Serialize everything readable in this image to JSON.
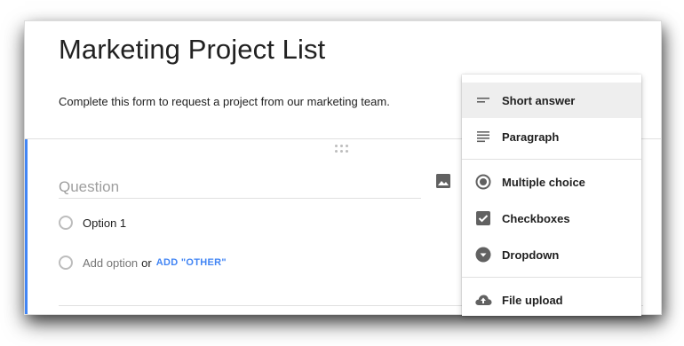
{
  "form": {
    "title": "Marketing Project List",
    "description": "Complete this form to request a project from our marketing team."
  },
  "question": {
    "placeholder": "Question",
    "options": [
      {
        "label": "Option 1"
      }
    ],
    "add_option_label": "Add option",
    "or_label": "or",
    "add_other_label": "ADD \"OTHER\""
  },
  "type_menu": {
    "items": [
      {
        "label": "Short answer",
        "icon": "short-answer-icon",
        "selected": true
      },
      {
        "label": "Paragraph",
        "icon": "paragraph-icon",
        "selected": false
      },
      {
        "label": "Multiple choice",
        "icon": "radio-icon",
        "selected": false
      },
      {
        "label": "Checkboxes",
        "icon": "checkbox-icon",
        "selected": false
      },
      {
        "label": "Dropdown",
        "icon": "dropdown-icon",
        "selected": false
      },
      {
        "label": "File upload",
        "icon": "cloud-upload-icon",
        "selected": false
      }
    ]
  },
  "colors": {
    "accent": "#4285f4",
    "text": "#212121",
    "icon": "#616161",
    "selected_bg": "#eeeeee"
  }
}
